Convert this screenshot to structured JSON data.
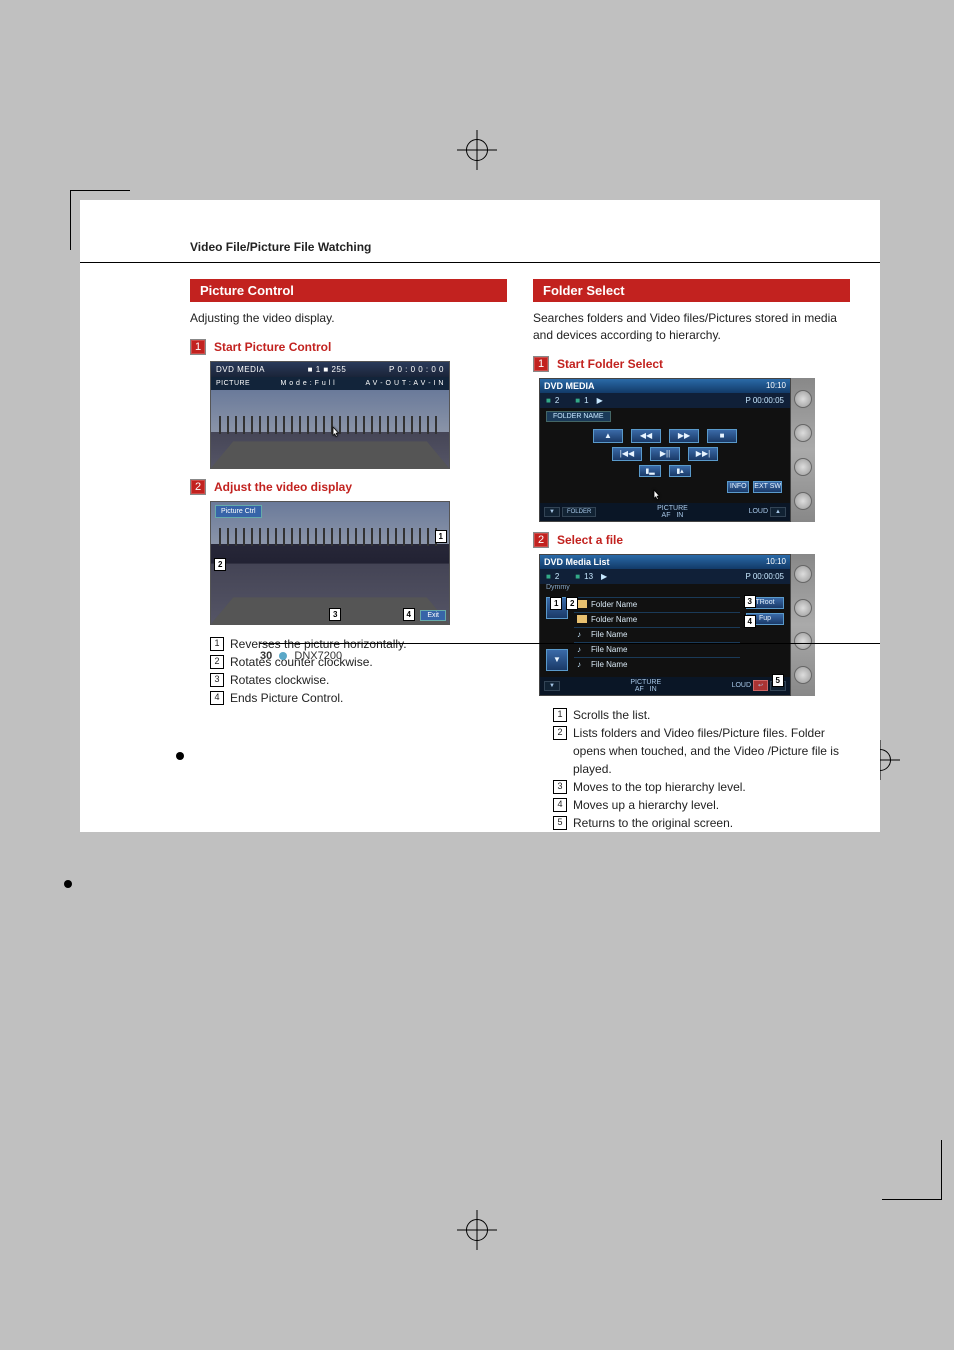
{
  "header": {
    "breadcrumb": "Video File/Picture File Watching"
  },
  "left": {
    "section_title": "Picture Control",
    "intro": "Adjusting the video display.",
    "step1": {
      "num": "1",
      "label": "Start Picture Control"
    },
    "ss1": {
      "title": "DVD MEDIA",
      "meta_left": "■ 1   ■ 255",
      "meta_right_1": "P  0 : 0 0 : 0 0",
      "line2_left": "PICTURE",
      "line2_mid": "M o d e :  F u l l",
      "line2_right": "A V - O U T : A V - I N"
    },
    "step2": {
      "num": "2",
      "label": "Adjust the video display"
    },
    "ss2": {
      "tab": "Picture Ctrl",
      "exit": "Exit",
      "c1": "1",
      "c2": "2",
      "c3": "3",
      "c4": "4"
    },
    "legend": [
      "Reverses the picture horizontally.",
      "Rotates counter clockwise.",
      "Rotates clockwise.",
      "Ends Picture Control."
    ]
  },
  "right": {
    "section_title": "Folder Select",
    "intro": "Searches folders and Video files/Pictures stored in media and devices according to hierarchy.",
    "step1": {
      "num": "1",
      "label": "Start Folder Select"
    },
    "ss1": {
      "title": "DVD MEDIA",
      "clock": "10:10",
      "status_a": "2",
      "status_b": "1",
      "status_c": "P   00:00:05",
      "foldername_label": "FOLDER NAME",
      "info": "INFO",
      "extsw": "EXT SW",
      "bottom": {
        "folder": "FOLDER",
        "picture": "PICTURE",
        "af": "AF",
        "in": "IN",
        "loud": "LOUD"
      }
    },
    "step2": {
      "num": "2",
      "label": "Select a file"
    },
    "ss2": {
      "title": "DVD Media List",
      "clock": "10:10",
      "status_a": "2",
      "status_b": "13",
      "status_c": "P   00:00:05",
      "dymmy": "Dymmy",
      "rows": [
        {
          "icon": "folder",
          "label": "Folder Name"
        },
        {
          "icon": "folder",
          "label": "Folder Name"
        },
        {
          "icon": "note",
          "label": "File Name"
        },
        {
          "icon": "note",
          "label": "File Name"
        },
        {
          "icon": "note",
          "label": "File Name"
        }
      ],
      "troot": "TRoot",
      "fup": "Fup",
      "bottom": {
        "picture": "PICTURE",
        "af": "AF",
        "in": "IN",
        "loud": "LOUD"
      },
      "c1": "1",
      "c2": "2",
      "c3": "3",
      "c4": "4",
      "c5": "5"
    },
    "legend": [
      "Scrolls the list.",
      "Lists folders and Video files/Picture files. Folder opens when touched, and the Video /Picture file is played.",
      "Moves to the top hierarchy level.",
      "Moves up a hierarchy level.",
      "Returns to the original screen."
    ]
  },
  "footer": {
    "page": "30",
    "model": "DNX7200"
  }
}
